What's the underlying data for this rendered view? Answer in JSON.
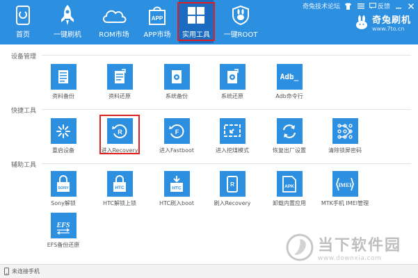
{
  "window": {
    "forum_link": "奇兔技术论坛",
    "feedback": "反馈"
  },
  "nav": {
    "items": [
      {
        "label": "首页",
        "icon": "home-icon"
      },
      {
        "label": "一键刷机",
        "icon": "rocket-icon"
      },
      {
        "label": "ROM市场",
        "icon": "cloud-icon"
      },
      {
        "label": "APP市场",
        "icon": "app-bag-icon"
      },
      {
        "label": "实用工具",
        "icon": "grid-icon",
        "active": true
      },
      {
        "label": "一键ROOT",
        "icon": "rabbit-shield-icon"
      }
    ]
  },
  "brand": {
    "name": "奇兔刷机",
    "url": "www.7to.cn"
  },
  "sections": [
    {
      "title": "设备管理",
      "tiles": [
        {
          "label": "资料备份",
          "icon": "document-icon"
        },
        {
          "label": "资料还原",
          "icon": "document-restore-icon"
        },
        {
          "label": "系统备份",
          "icon": "system-backup-icon"
        },
        {
          "label": "系统还原",
          "icon": "system-restore-icon"
        },
        {
          "label": "Adb命令行",
          "icon": "adb-icon",
          "icon_text": "Adb_"
        }
      ]
    },
    {
      "title": "快捷工具",
      "tiles": [
        {
          "label": "重启设备",
          "icon": "restart-icon"
        },
        {
          "label": "进入Recovery",
          "icon": "recovery-icon",
          "icon_text": "R"
        },
        {
          "label": "进入Fastboot",
          "icon": "fastboot-icon",
          "icon_text": "F"
        },
        {
          "label": "进入挖煤模式",
          "icon": "download-mode-icon"
        },
        {
          "label": "恢复出厂设置",
          "icon": "factory-reset-icon"
        },
        {
          "label": "清除锁屏密码",
          "icon": "pattern-lock-icon"
        }
      ]
    },
    {
      "title": "辅助工具",
      "tiles": [
        {
          "label": "Sony解锁",
          "icon": "sony-lock-icon",
          "icon_text": "SONY"
        },
        {
          "label": "HTC解锁上锁",
          "icon": "htc-lock-icon",
          "icon_text": "HTC"
        },
        {
          "label": "HTC刷入boot",
          "icon": "htc-boot-icon",
          "icon_text": "HTC"
        },
        {
          "label": "刷入Recovery",
          "icon": "flash-recovery-icon",
          "icon_text": "R"
        },
        {
          "label": "卸载内置应用",
          "icon": "apk-icon",
          "icon_text": "APK"
        },
        {
          "label": "MTK手机 IMEI管理",
          "icon": "imei-icon",
          "icon_text": "IMEI"
        },
        {
          "label": "EFS备份还原",
          "icon": "efs-icon",
          "icon_text": "EFS"
        }
      ]
    }
  ],
  "status": {
    "text": "未连接手机"
  },
  "watermark": {
    "name": "当下软件园",
    "url": "www.downxia.com"
  },
  "colors": {
    "topbar": "#2d8fe0",
    "tile": "#2d8fe0",
    "highlight": "#e02020"
  }
}
